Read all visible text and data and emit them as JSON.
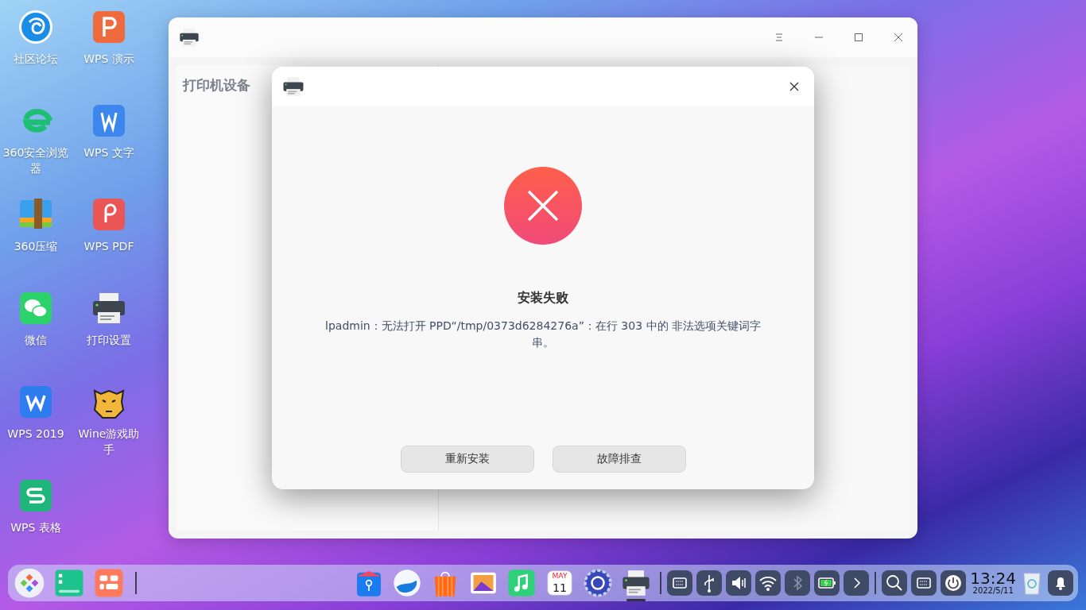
{
  "desktop": {
    "icons": [
      {
        "label": "社区论坛",
        "kind": "forum"
      },
      {
        "label": "WPS 演示",
        "kind": "wps-presentation"
      },
      {
        "label": "360安全浏览器",
        "kind": "browser-e"
      },
      {
        "label": "WPS 文字",
        "kind": "wps-writer"
      },
      {
        "label": "360压缩",
        "kind": "archive"
      },
      {
        "label": "WPS PDF",
        "kind": "wps-pdf"
      },
      {
        "label": "微信",
        "kind": "chat"
      },
      {
        "label": "打印设置",
        "kind": "printer"
      },
      {
        "label": "WPS 2019",
        "kind": "wps-2019"
      },
      {
        "label": "Wine游戏助手",
        "kind": "tiger"
      },
      {
        "label": "WPS 表格",
        "kind": "wps-sheet"
      }
    ]
  },
  "window": {
    "sidebar_title": "打印机设备"
  },
  "dialog": {
    "title": "安装失败",
    "message": "lpadmin：无法打开 PPD“/tmp/0373d6284276a”：在行 303 中的 非法选项关键词字串。",
    "buttons": [
      "重新安装",
      "故障排查"
    ]
  },
  "dock": {
    "left": [
      {
        "kind": "launcher"
      },
      {
        "kind": "multitask"
      },
      {
        "kind": "workspaces"
      }
    ],
    "apps": [
      {
        "kind": "store",
        "active": false
      },
      {
        "kind": "browser-wave",
        "active": false
      },
      {
        "kind": "shop",
        "active": false
      },
      {
        "kind": "photos",
        "active": false
      },
      {
        "kind": "music",
        "active": false
      },
      {
        "kind": "calendar",
        "active": false,
        "month": "MAY",
        "day": "11"
      },
      {
        "kind": "settings",
        "active": false
      },
      {
        "kind": "printer",
        "active": true
      }
    ],
    "tray": [
      {
        "kind": "keyboard",
        "enabled": true
      },
      {
        "kind": "usb",
        "enabled": true
      },
      {
        "kind": "volume",
        "enabled": true
      },
      {
        "kind": "wifi",
        "enabled": true
      },
      {
        "kind": "bluetooth",
        "enabled": false
      },
      {
        "kind": "battery",
        "enabled": true
      },
      {
        "kind": "expand",
        "enabled": true
      }
    ],
    "system": [
      {
        "kind": "search"
      },
      {
        "kind": "keyboard-layout"
      },
      {
        "kind": "power"
      }
    ],
    "clock": {
      "time": "13:24",
      "date": "2022/5/11"
    }
  }
}
